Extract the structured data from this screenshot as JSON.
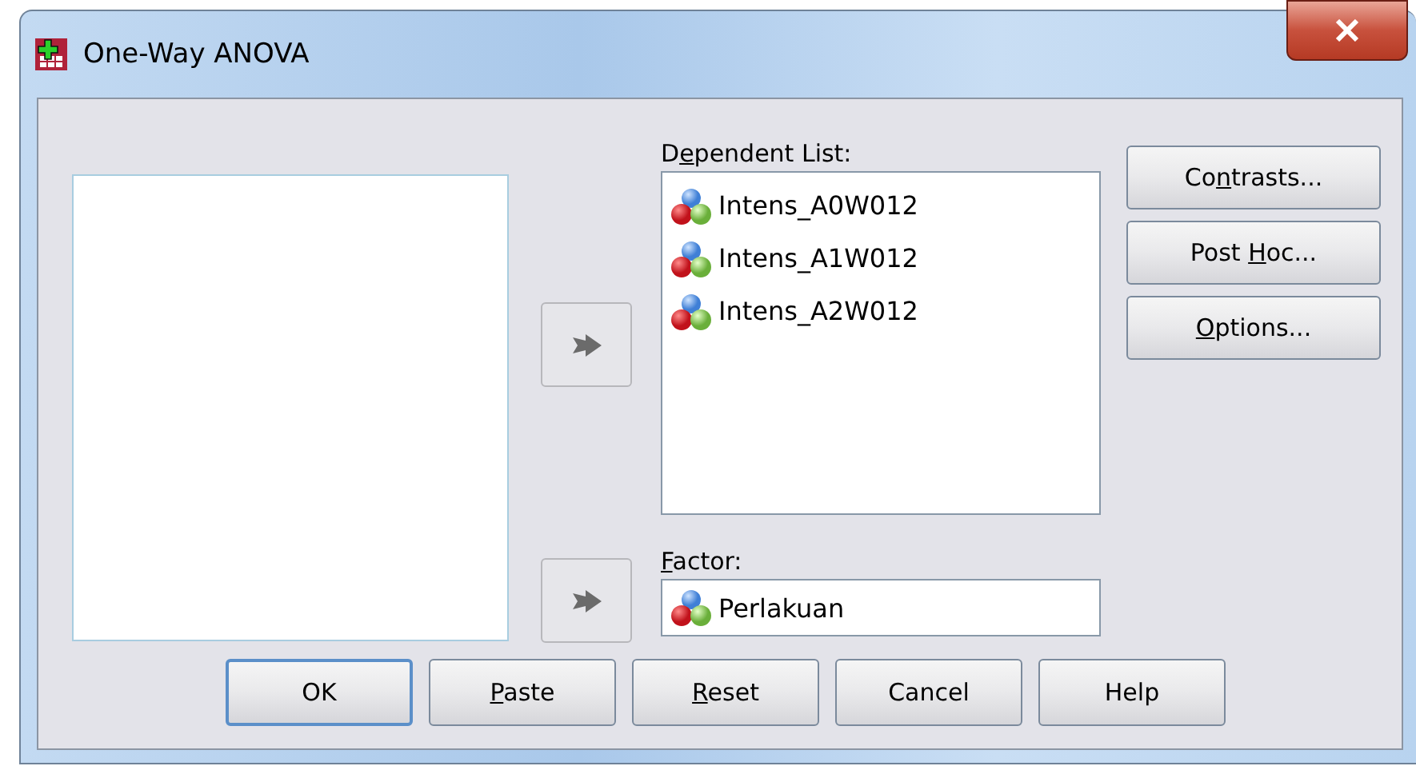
{
  "window": {
    "title": "One-Way ANOVA"
  },
  "dependent_list": {
    "label": {
      "pre": "D",
      "key": "e",
      "post": "pendent List:"
    },
    "items": [
      {
        "name": "Intens_A0W012",
        "selected": false
      },
      {
        "name": "Intens_A1W012",
        "selected": false
      },
      {
        "name": "Intens_A2W012",
        "selected": false
      }
    ]
  },
  "factor": {
    "label": {
      "key": "F",
      "post": "actor:"
    },
    "value": "Perlakuan"
  },
  "side_buttons": [
    {
      "pre": "Co",
      "key": "n",
      "post": "trasts..."
    },
    {
      "pre": "Post ",
      "key": "H",
      "post": "oc..."
    },
    {
      "key": "O",
      "post": "ptions..."
    }
  ],
  "bottom_buttons": [
    {
      "pre": "OK",
      "default": true
    },
    {
      "key": "P",
      "post": "aste",
      "default": false
    },
    {
      "key": "R",
      "post": "eset",
      "default": false
    },
    {
      "pre": "Cancel",
      "default": false
    },
    {
      "pre": "Help",
      "default": false
    }
  ]
}
